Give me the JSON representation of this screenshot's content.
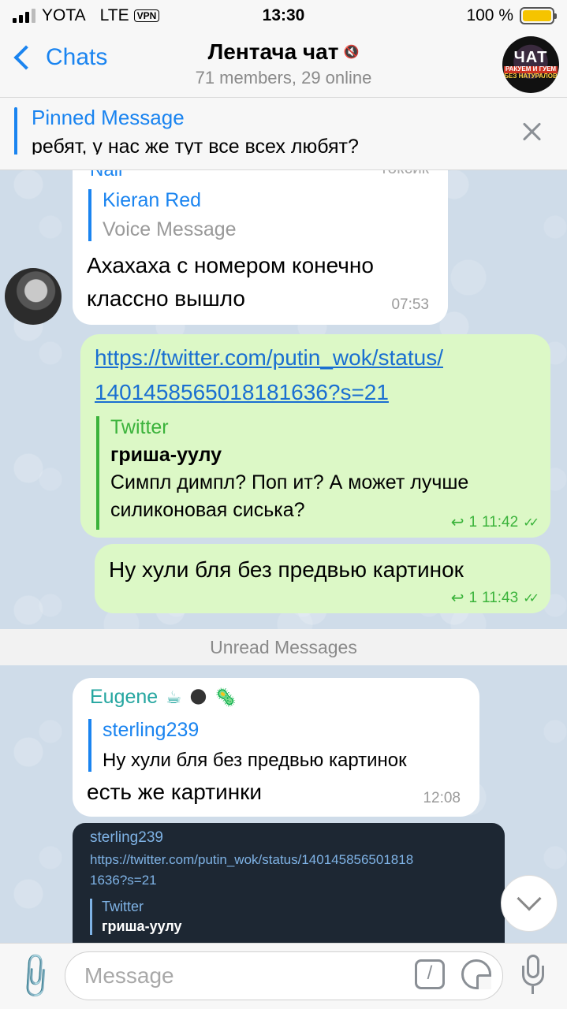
{
  "status_bar": {
    "carrier": "YOTA",
    "network": "LTE",
    "vpn": "VPN",
    "time": "13:30",
    "battery_text": "100 %",
    "battery_level": 1.0
  },
  "header": {
    "back_label": "Chats",
    "title": "Лентача чат",
    "subtitle": "71 members, 29 online",
    "avatar_texts": [
      "ЧАТ",
      "РАКУЕМ И ГУЕМ",
      "БЕЗ НАТУРАЛОВ"
    ]
  },
  "pinned": {
    "title": "Pinned Message",
    "text": "ребят, у нас же тут все всех любят?"
  },
  "messages": {
    "m1": {
      "partial_sender": "Nail",
      "partial_badge": "токсик",
      "quote_name": "Kieran Red",
      "quote_text": "Voice Message",
      "line1": "Ахахаха с номером конечно",
      "line2": "классно вышло",
      "time": "07:53"
    },
    "m2": {
      "link_line1": "https://twitter.com/putin_wok/status/",
      "link_line2": "1401458565018181636?s=21",
      "preview_site": "Twitter",
      "preview_title": "гриша-уулу",
      "preview_line1": "Симпл димпл? Поп ит? А может лучше",
      "preview_line2": "силиконовая сиська?",
      "replies": "1",
      "time": "11:42"
    },
    "m3": {
      "text": "Ну хули бля без предвью картинок",
      "replies": "1",
      "time": "11:43"
    },
    "unread_label": "Unread Messages",
    "m4": {
      "sender": "Eugene",
      "emojis": [
        "☕",
        "🌑",
        "🦠"
      ],
      "quote_name": "sterling239",
      "quote_text": "Ну хули бля без предвью картинок",
      "text": "есть же картинки",
      "time": "12:08"
    },
    "m5": {
      "name": "sterling239",
      "link_line1": "https://twitter.com/putin_wok/status/140145856501818",
      "link_line2": "1636?s=21",
      "quote_site": "Twitter",
      "quote_title": "гриша-уулу"
    }
  },
  "input": {
    "placeholder": "Message",
    "cmd_glyph": "/"
  }
}
